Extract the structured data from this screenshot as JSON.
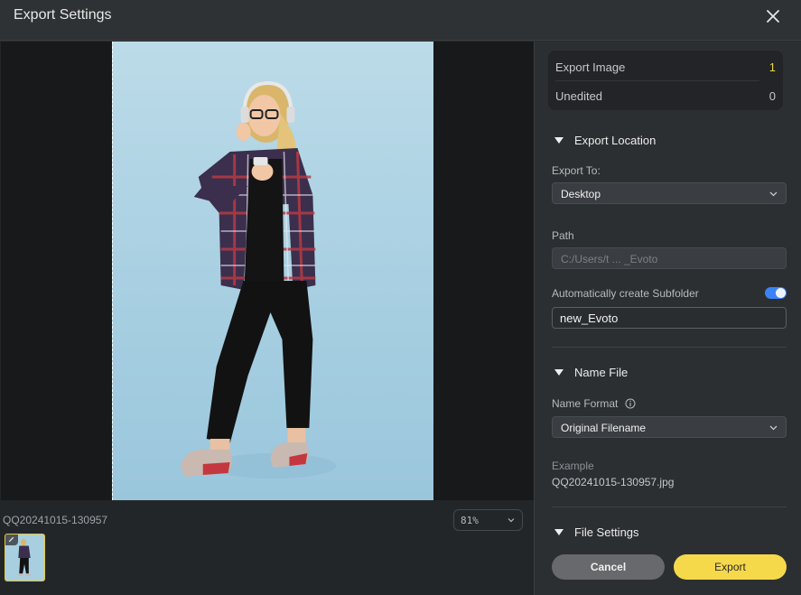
{
  "window": {
    "title": "Export Settings",
    "close_icon": "close-icon"
  },
  "preview": {
    "filename": "QQ20241015-130957",
    "zoom_level": "81%",
    "thumbnails": [
      {
        "name": "QQ20241015-130957",
        "selected": true,
        "edited": true
      }
    ]
  },
  "summary": {
    "export_image_label": "Export Image",
    "export_image_count": "1",
    "unedited_label": "Unedited",
    "unedited_count": "0"
  },
  "export_location": {
    "section_label": "Export Location",
    "export_to_label": "Export To:",
    "export_to_value": "Desktop",
    "path_label": "Path",
    "path_value": "C:/Users/t ... _Evoto",
    "subfolder_label": "Automatically create Subfolder",
    "subfolder_enabled": true,
    "subfolder_name": "new_Evoto"
  },
  "name_file": {
    "section_label": "Name File",
    "name_format_label": "Name Format",
    "name_format_value": "Original Filename",
    "example_label": "Example",
    "example_value": "QQ20241015-130957.jpg"
  },
  "file_settings": {
    "section_label": "File Settings"
  },
  "actions": {
    "cancel_label": "Cancel",
    "export_label": "Export"
  },
  "colors": {
    "accent_yellow": "#f6d94a",
    "toggle_blue": "#3b82f6",
    "count_yellow": "#e7d44a"
  }
}
